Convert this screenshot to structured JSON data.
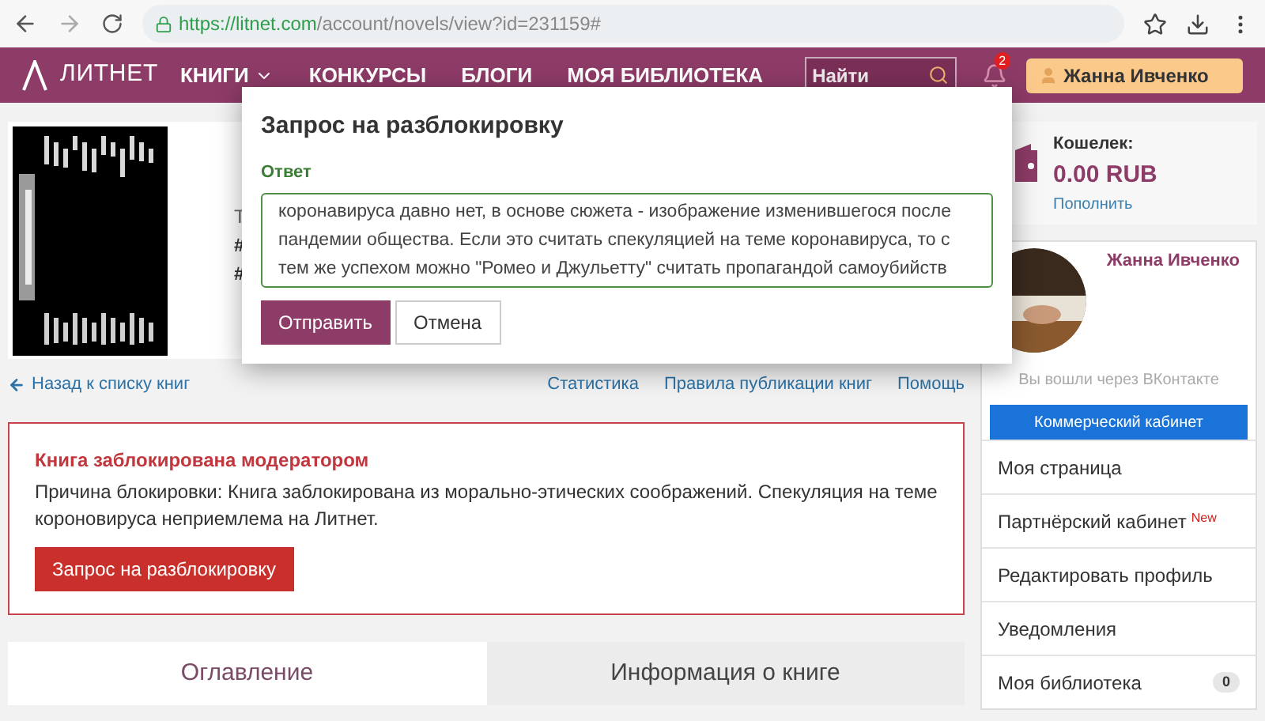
{
  "browser": {
    "url_host": "https://litnet.com",
    "url_path": "/account/novels/view?id=231159#"
  },
  "nav": {
    "logo": "ЛИТНЕТ",
    "items": [
      {
        "label": "КНИГИ",
        "dropdown": true
      },
      {
        "label": "КОНКУРСЫ",
        "dropdown": false
      },
      {
        "label": "БЛОГИ",
        "dropdown": false
      },
      {
        "label": "МОЯ БИБЛИОТЕКА",
        "dropdown": false
      }
    ],
    "search": {
      "placeholder": "Найти"
    },
    "notifications": "2",
    "user": "Жанна Ивченко"
  },
  "book": {
    "fragments": [
      "Т",
      "#",
      "#"
    ]
  },
  "links": {
    "back": "Назад к списку книг",
    "right": [
      "Статистика",
      "Правила публикации книг",
      "Помощь"
    ]
  },
  "alert": {
    "title": "Книга заблокирована модератором",
    "text": "Причина блокировки: Книга заблокирована из морально-этических соображений. Спекуляция на теме короновируса неприемлема на Литнет.",
    "button": "Запрос на разблокировку"
  },
  "tabs": [
    {
      "label": "Оглавление",
      "selected": true
    },
    {
      "label": "Информация о книге",
      "selected": false
    }
  ],
  "wallet": {
    "label": "Кошелек:",
    "amount": "0.00 RUB",
    "link": "Пополнить"
  },
  "profile": {
    "name": "Жанна Ивченко",
    "login_note": "Вы вошли через ВКонтакте",
    "commercial_button": "Коммерческий кабинет",
    "menu": [
      {
        "label": "Моя страница"
      },
      {
        "label": "Партнёрский кабинет",
        "badge": "New"
      },
      {
        "label": "Редактировать профиль"
      },
      {
        "label": "Уведомления"
      },
      {
        "label": "Моя библиотека",
        "count": "0"
      }
    ]
  },
  "modal": {
    "title": "Запрос на разблокировку",
    "field_label": "Ответ",
    "value": "коронавируса давно нет, в основе сюжета - изображение изменившегося после пандемии общества. Если это считать спекуляцией на теме коронавируса, то с тем же успехом можно \"Ромео и Джульетту\" считать пропагандой самоубийств",
    "buttons": [
      {
        "label": "Отправить",
        "kind": "primary"
      },
      {
        "label": "Отмена",
        "kind": "secondary"
      }
    ]
  }
}
